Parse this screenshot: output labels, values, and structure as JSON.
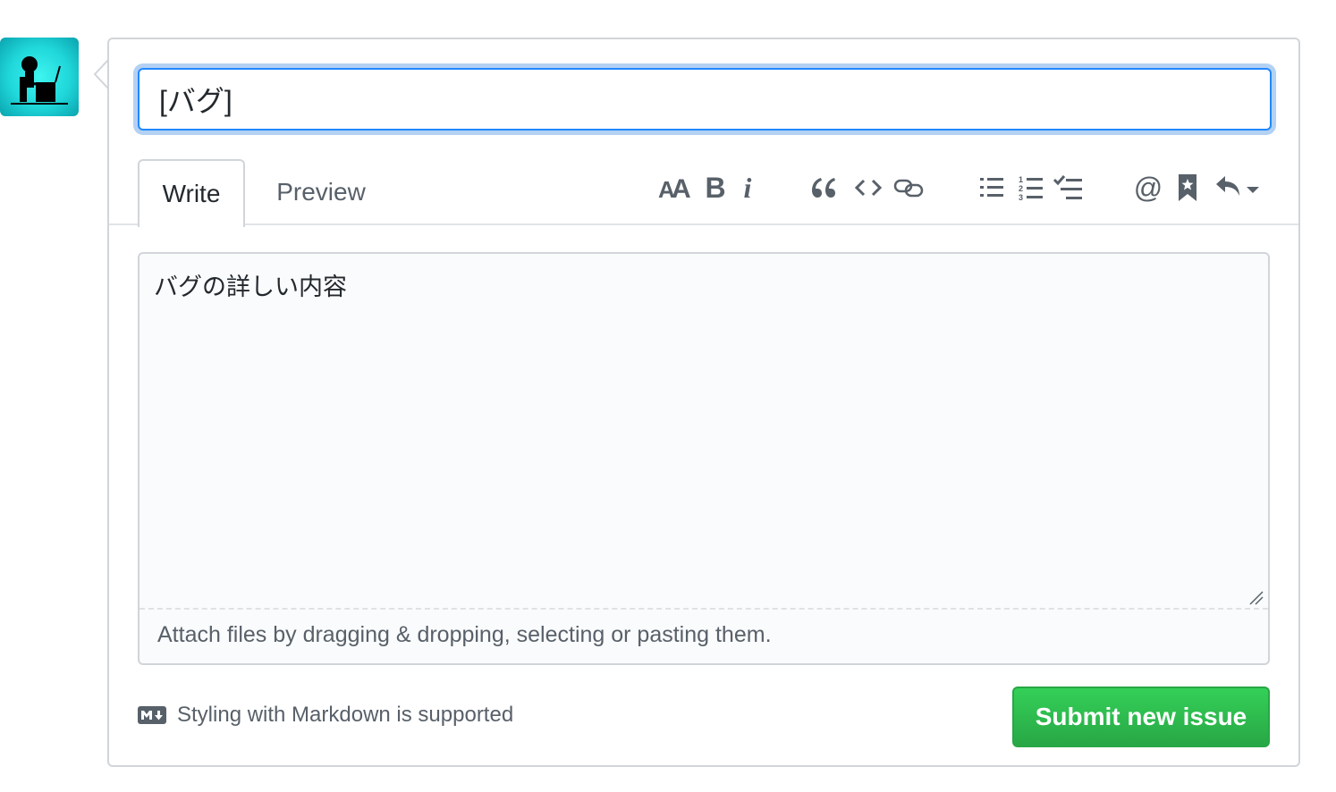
{
  "issue_form": {
    "title_value": "[バグ]",
    "tabs": {
      "write_label": "Write",
      "preview_label": "Preview"
    },
    "toolbar": {
      "heading_icon": "text-size-icon",
      "heading_label": "AA",
      "bold_icon": "bold-icon",
      "bold_label": "B",
      "italic_icon": "italic-icon",
      "italic_label": "i",
      "quote_icon": "quote-icon",
      "code_icon": "code-icon",
      "link_icon": "link-icon",
      "unordered_list_icon": "list-unordered-icon",
      "ordered_list_icon": "list-ordered-icon",
      "task_list_icon": "tasklist-icon",
      "mention_icon": "mention-icon",
      "mention_label": "@",
      "reference_icon": "bookmark-icon",
      "saved_reply_icon": "reply-icon"
    },
    "body_value": "バグの詳しい内容",
    "attach_text": "Attach files by dragging & dropping, selecting or pasting them.",
    "markdown_hint": "Styling with Markdown is supported",
    "submit_label": "Submit new issue"
  },
  "colors": {
    "focus_border": "#2188ff",
    "submit_green": "#28a745",
    "muted_text": "#586069",
    "border": "#d1d5da"
  }
}
